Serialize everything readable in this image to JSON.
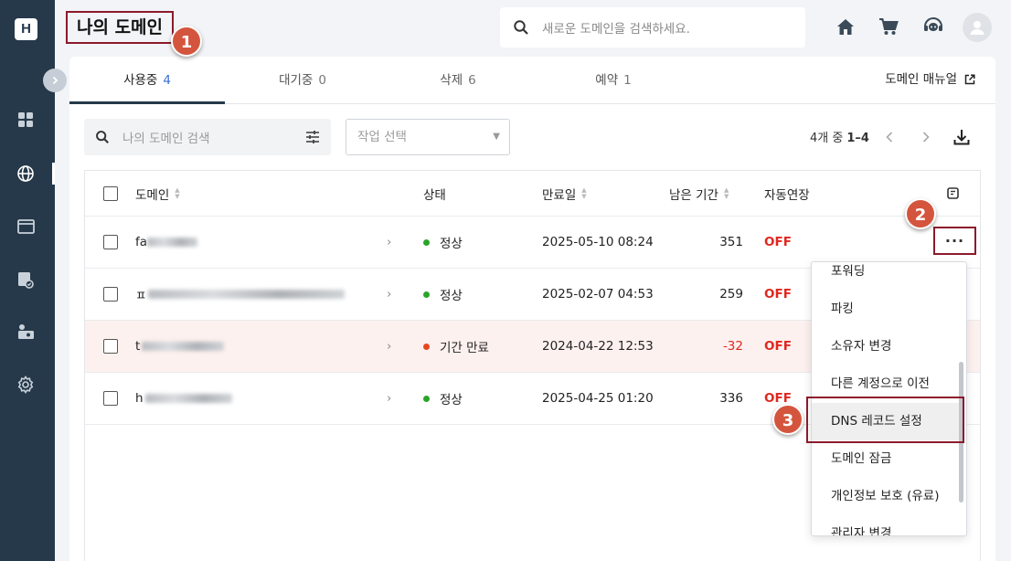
{
  "app": {
    "logo_letter": "H"
  },
  "header": {
    "title": "나의 도메인",
    "search_placeholder": "새로운 도메인을 검색하세요."
  },
  "tabs": [
    {
      "label": "사용중",
      "count": "4",
      "active": true
    },
    {
      "label": "대기중",
      "count": "0",
      "active": false
    },
    {
      "label": "삭제",
      "count": "6",
      "active": false
    },
    {
      "label": "예약",
      "count": "1",
      "active": false
    }
  ],
  "manual_link": "도메인 매뉴얼",
  "filter": {
    "search_placeholder": "나의 도메인 검색",
    "action_select": "작업 선택"
  },
  "pagination": {
    "prefix": "4개 중",
    "range": "1–4"
  },
  "table": {
    "columns": {
      "domain": "도메인",
      "status": "상태",
      "expiry": "만료일",
      "remaining": "남은 기간",
      "autorenew": "자동연장"
    },
    "rows": [
      {
        "domain_prefix": "fa",
        "status": "정상",
        "status_color": "#2aa52a",
        "expiry": "2025-05-10 08:24",
        "remaining": "351",
        "autorenew": "OFF",
        "expired": false
      },
      {
        "domain_prefix": "ㅍ",
        "status": "정상",
        "status_color": "#2aa52a",
        "expiry": "2025-02-07 04:53",
        "remaining": "259",
        "autorenew": "OFF",
        "expired": false
      },
      {
        "domain_prefix": "t",
        "status": "기간 만료",
        "status_color": "#e8461f",
        "expiry": "2024-04-22 12:53",
        "remaining": "-32",
        "autorenew": "OFF",
        "expired": true
      },
      {
        "domain_prefix": "h",
        "status": "정상",
        "status_color": "#2aa52a",
        "expiry": "2025-04-25 01:20",
        "remaining": "336",
        "autorenew": "OFF",
        "expired": false
      }
    ]
  },
  "row_menu": {
    "items": [
      "포워딩",
      "파킹",
      "소유자 변경",
      "다른 계정으로 이전",
      "DNS 레코드 설정",
      "도메인 잠금",
      "개인정보 보호 (유료)",
      "관리자 변경"
    ],
    "highlighted_index": 4
  },
  "markers": [
    "1",
    "2",
    "3"
  ],
  "colors": {
    "accent": "#3b6fd6",
    "rail": "#26394a",
    "highlight_border": "#8b1a2b",
    "marker": "#d4553d",
    "off": "#e0271f"
  }
}
